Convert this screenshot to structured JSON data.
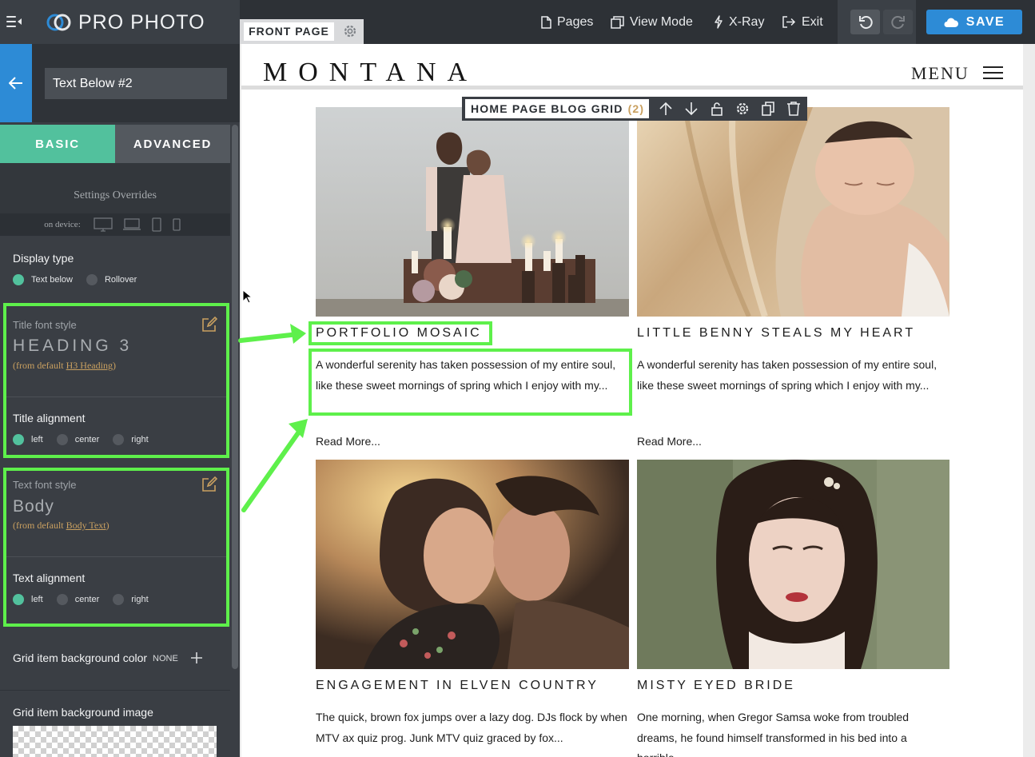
{
  "app": {
    "brand": "PRO PHOTO",
    "page_tab": "FRONT PAGE",
    "nav": {
      "pages": "Pages",
      "view_mode": "View Mode",
      "xray": "X-Ray",
      "exit": "Exit"
    },
    "save": "SAVE"
  },
  "sidebar": {
    "block_name": "Text Below #2",
    "tabs": [
      "BASIC",
      "ADVANCED"
    ],
    "overrides_title": "Settings Overrides",
    "on_device": "on device:",
    "display_type": {
      "label": "Display type",
      "options": [
        "Text below",
        "Rollover"
      ],
      "selected": "Text below"
    },
    "title_font": {
      "label": "Title font style",
      "value": "HEADING 3",
      "from_prefix": "(from default ",
      "from_link": "H3 Heading",
      "from_suffix": ")"
    },
    "title_alignment": {
      "label": "Title alignment",
      "options": [
        "left",
        "center",
        "right"
      ],
      "selected": "left"
    },
    "text_font": {
      "label": "Text font style",
      "value": "Body",
      "from_prefix": "(from default ",
      "from_link": "Body Text",
      "from_suffix": ")"
    },
    "text_alignment": {
      "label": "Text alignment",
      "options": [
        "left",
        "center",
        "right"
      ],
      "selected": "left"
    },
    "grid_bg_color": {
      "label": "Grid item background color",
      "value": "NONE"
    },
    "grid_bg_image": {
      "label": "Grid item background image"
    }
  },
  "site": {
    "logo": "MONTANA",
    "menu": "MENU",
    "block_toolbar": {
      "label": "HOME PAGE BLOG GRID",
      "count": "(2)"
    },
    "posts": [
      {
        "title": "PORTFOLIO MOSAIC",
        "excerpt": "A wonderful serenity has taken possession of my entire soul, like these sweet mornings of spring which I enjoy with my...",
        "read_more": "Read More..."
      },
      {
        "title": "LITTLE BENNY STEALS MY HEART",
        "excerpt": "A wonderful serenity has taken possession of my entire soul, like these sweet mornings of spring which I enjoy with my...",
        "read_more": "Read More..."
      },
      {
        "title": "ENGAGEMENT IN ELVEN COUNTRY",
        "excerpt": "The quick, brown fox jumps over a lazy dog. DJs flock by when MTV ax quiz prog. Junk MTV quiz graced by fox..."
      },
      {
        "title": "MISTY EYED BRIDE",
        "excerpt": "One morning, when Gregor Samsa woke from troubled dreams, he found himself transformed in his bed into a horrible..."
      }
    ]
  },
  "colors": {
    "accent_green": "#52c19d",
    "highlight_green": "#5ef04b",
    "save_blue": "#2d8bd6",
    "link_gold": "#c9a060"
  },
  "icons": [
    "menu-collapse-icon",
    "pro-photo-logo-icon",
    "gear-icon",
    "page-icon",
    "view-mode-icon",
    "xray-icon",
    "exit-icon",
    "undo-icon",
    "redo-icon",
    "save-icon",
    "back-arrow-icon",
    "desktop-icon",
    "laptop-icon",
    "tablet-icon",
    "phone-icon",
    "edit-icon",
    "plus-icon",
    "move-up-icon",
    "move-down-icon",
    "lock-icon",
    "copy-icon",
    "trash-icon"
  ]
}
